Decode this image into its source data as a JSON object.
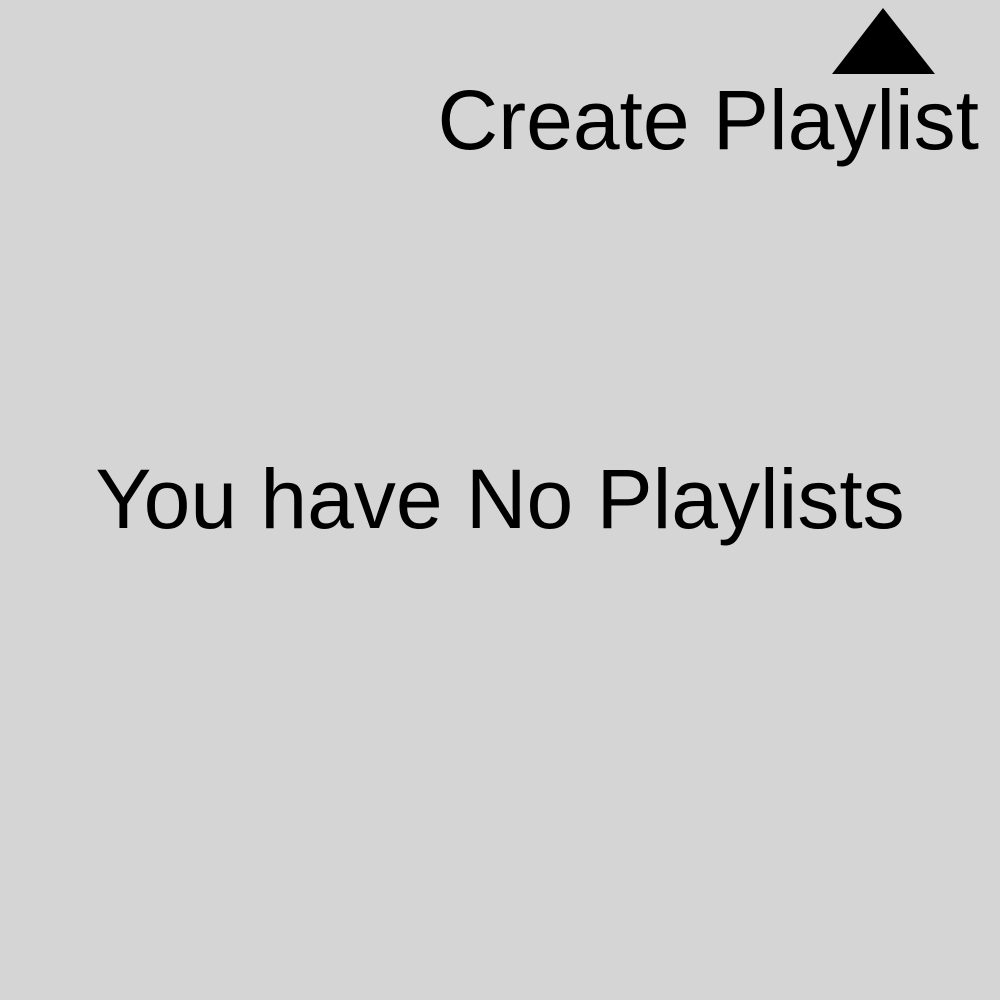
{
  "header": {
    "create_playlist_label": "Create Playlist",
    "create_icon": "triangle-up-icon"
  },
  "main": {
    "empty_message": "You have No Playlists"
  },
  "colors": {
    "background": "#d5d5d5",
    "text": "#000000"
  }
}
